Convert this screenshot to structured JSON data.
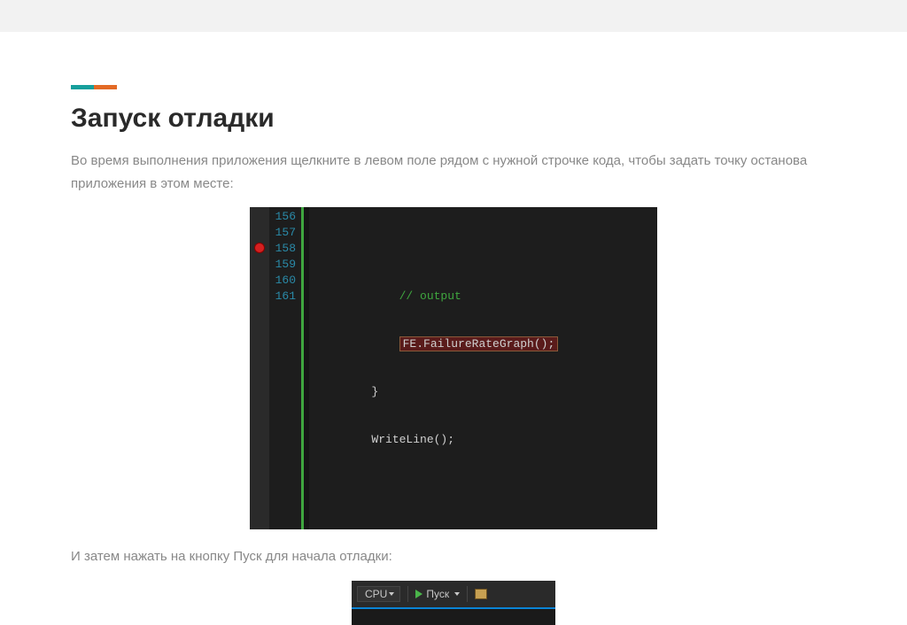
{
  "heading": "Запуск отладки",
  "paragraph1": "Во время выполнения приложения щелкните в левом поле рядом с нужной строчке кода, чтобы задать точку останова приложения в этом месте:",
  "paragraph2": "И затем нажать на кнопку Пуск для начала отладки:",
  "editor": {
    "line_numbers": [
      "156",
      "157",
      "158",
      "159",
      "160",
      "161"
    ],
    "code": {
      "l157": "// output",
      "l158": "FE.FailureRateGraph();",
      "l159": "}",
      "l160": "WriteLine();"
    }
  },
  "toolbar": {
    "cpu": "CPU",
    "start": "Пуск"
  }
}
